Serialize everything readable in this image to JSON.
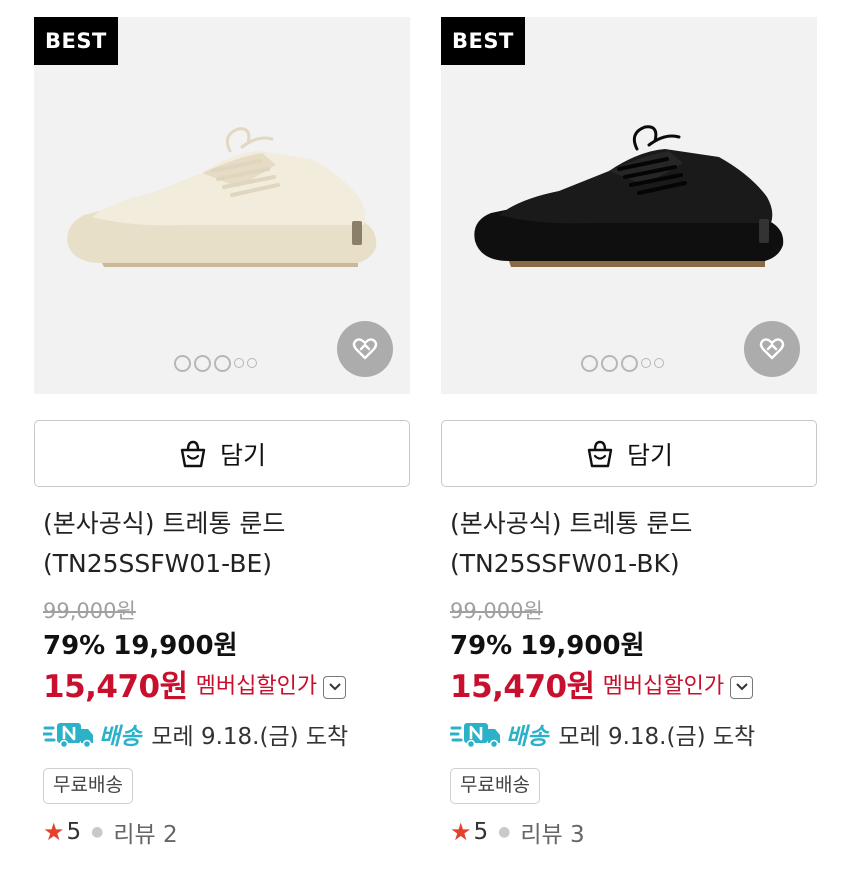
{
  "products": [
    {
      "badge": "BEST",
      "image": "shoe-cream",
      "cart_label": "담기",
      "title_line1": "(본사공식) 트레통 룬드",
      "title_line2": "(TN25SSFW01-BE)",
      "original_price": "99,000원",
      "discount": "79%",
      "sale_price": "19,900원",
      "member_price": "15,470원",
      "member_label": "멤버십할인가",
      "shipping_label": "배송",
      "shipping_eta": "모레 9.18.(금) 도착",
      "tag": "무료배송",
      "rating": "5",
      "review_label": "리뷰 2"
    },
    {
      "badge": "BEST",
      "image": "shoe-black",
      "cart_label": "담기",
      "title_line1": "(본사공식) 트레통 룬드",
      "title_line2": "(TN25SSFW01-BK)",
      "original_price": "99,000원",
      "discount": "79%",
      "sale_price": "19,900원",
      "member_price": "15,470원",
      "member_label": "멤버십할인가",
      "shipping_label": "배송",
      "shipping_eta": "모레 9.18.(금) 도착",
      "tag": "무료배송",
      "rating": "5",
      "review_label": "리뷰 3"
    }
  ],
  "colors": {
    "member_red": "#c8102e",
    "shipping_cyan": "#2bb2c9",
    "star_red": "#e4422e",
    "badge_black": "#000000",
    "cream_shoe": "#efe8d6",
    "black_shoe": "#151515"
  },
  "icons": {
    "cart": "shopping-bag-icon",
    "wish": "heart-icon",
    "chevron": "chevron-down-icon",
    "truck": "delivery-truck-icon",
    "star": "star-icon"
  }
}
